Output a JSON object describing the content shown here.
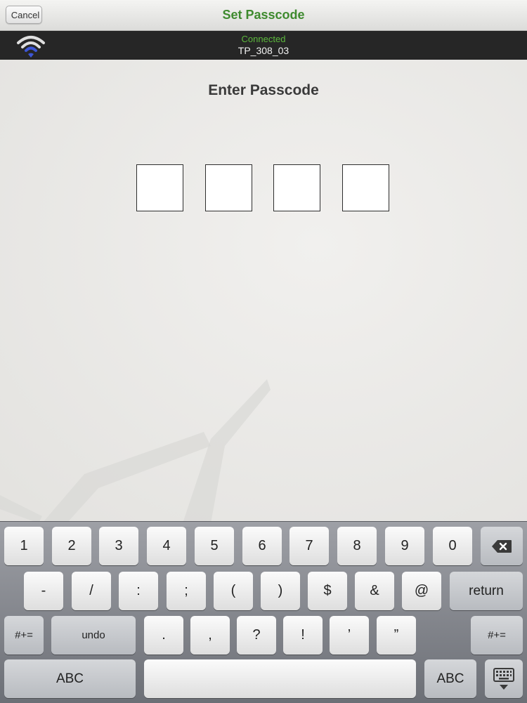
{
  "navbar": {
    "cancel_label": "Cancel",
    "title": "Set Passcode"
  },
  "status": {
    "connected_text": "Connected",
    "ssid": "TP_308_03",
    "wifi_icon": "wifi-icon"
  },
  "main": {
    "prompt": "Enter Passcode",
    "passcode_digits": [
      "",
      "",
      "",
      ""
    ]
  },
  "keyboard": {
    "row1": [
      "1",
      "2",
      "3",
      "4",
      "5",
      "6",
      "7",
      "8",
      "9",
      "0"
    ],
    "backspace_icon": "backspace-icon",
    "row2": [
      "-",
      "/",
      ":",
      ";",
      "(",
      ")",
      "$",
      "&",
      "@"
    ],
    "return_label": "return",
    "row3_left": "#+=",
    "undo_label": "undo",
    "row3": [
      ".",
      ",",
      "?",
      "!",
      "’",
      "”"
    ],
    "row3_right": "#+=",
    "abc_left": "ABC",
    "abc_right": "ABC",
    "hide_keyboard_icon": "hide-keyboard-icon"
  },
  "colors": {
    "title_green": "#3e8a2e",
    "connected_green": "#5cb83c",
    "wifi_blue": "#3d56d6"
  }
}
